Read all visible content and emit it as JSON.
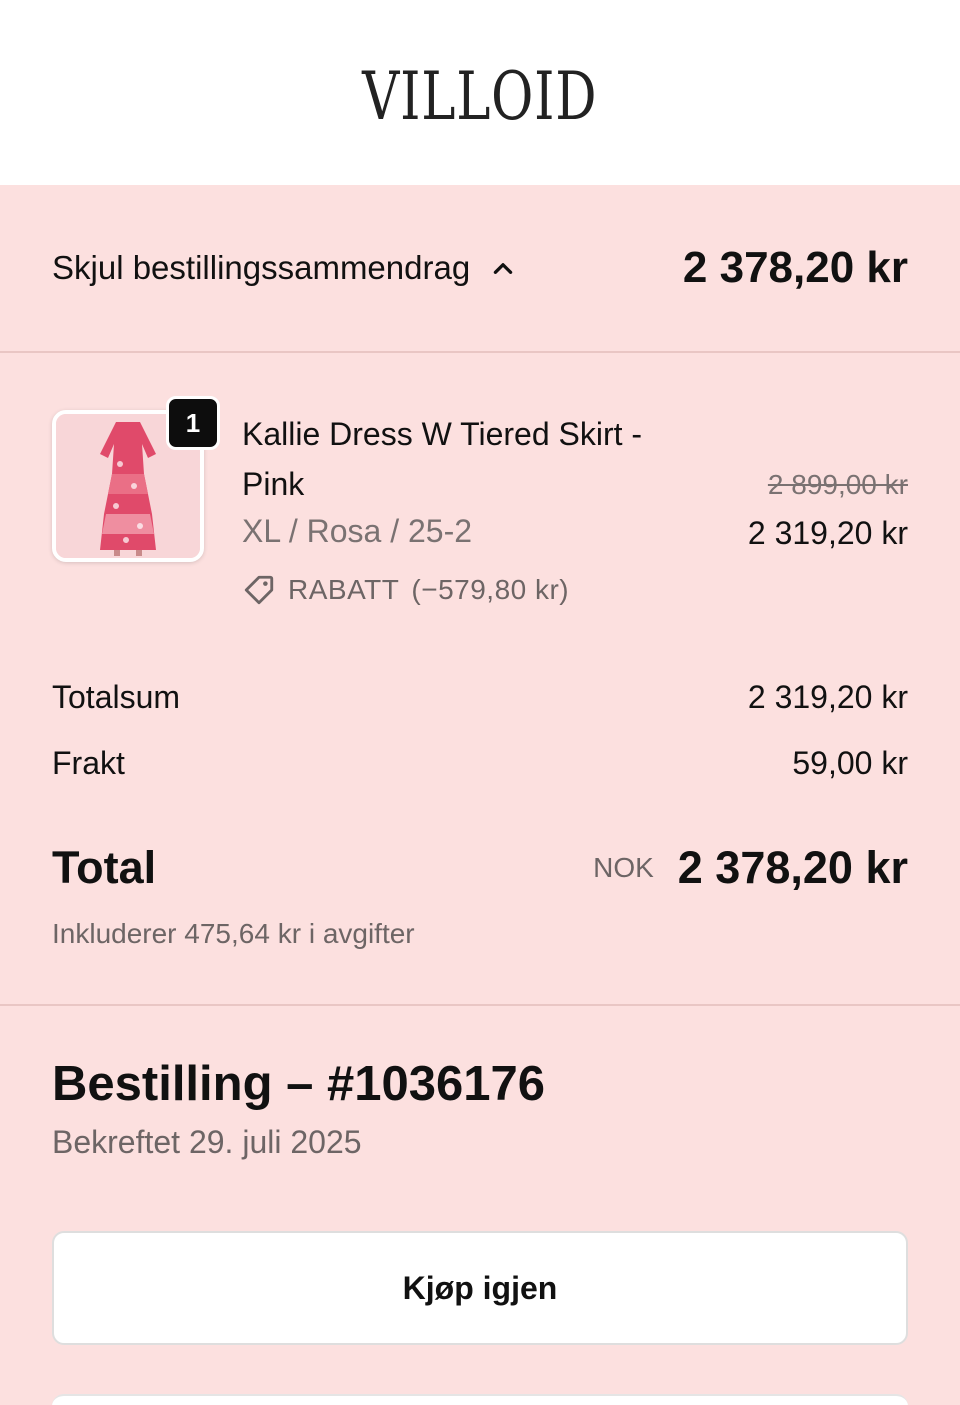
{
  "brand": {
    "logo_text": "VILLOID"
  },
  "summary": {
    "toggle_label": "Skjul bestillingssammendrag",
    "total": "2 378,20 kr"
  },
  "product": {
    "quantity": "1",
    "name": "Kallie Dress W Tiered Skirt - Pink",
    "variant": "XL / Rosa / 25-2",
    "discount_label": "RABATT",
    "discount_amount": "(−579,80 kr)",
    "original_price": "2 899,00 kr",
    "price": "2 319,20 kr",
    "image_icon": "dress-image"
  },
  "totals": {
    "subtotal_label": "Totalsum",
    "subtotal_value": "2 319,20 kr",
    "shipping_label": "Frakt",
    "shipping_value": "59,00 kr",
    "total_label": "Total",
    "currency": "NOK",
    "total_value": "2 378,20 kr",
    "taxes_note": "Inkluderer 475,64 kr i avgifter"
  },
  "order": {
    "title": "Bestilling – #1036176",
    "confirmed": "Bekreftet 29. juli 2025",
    "buy_again_label": "Kjøp igjen"
  },
  "colors": {
    "background": "#fce0df",
    "header": "#ffffff",
    "divider": "#e9c6c4",
    "badge": "#0d0d0d"
  }
}
